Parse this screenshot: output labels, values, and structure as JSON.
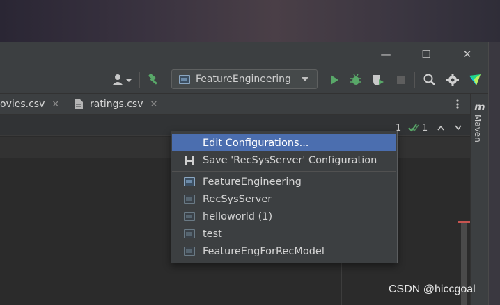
{
  "window": {
    "minimize_glyph": "—",
    "maximize_glyph": "☐",
    "close_glyph": "✕"
  },
  "toolbar": {
    "run_config_label": "FeatureEngineering",
    "icons": [
      "user-icon",
      "hammer-icon",
      "run-icon",
      "debug-icon",
      "coverage-icon",
      "stop-icon",
      "search-icon",
      "gear-icon",
      "toolbox-icon"
    ]
  },
  "tabs": [
    {
      "label": "ovies.csv",
      "close": "✕"
    },
    {
      "label": "ratings.csv",
      "close": "✕"
    }
  ],
  "inspections": {
    "warnings_count": "1",
    "ok_count": "1"
  },
  "sidebar": {
    "maven_label": "Maven",
    "maven_glyph": "m"
  },
  "dropdown": {
    "items": [
      {
        "label": "Edit Configurations...",
        "icon": "none",
        "selected": true
      },
      {
        "label": "Save 'RecSysServer' Configuration",
        "icon": "save-icon",
        "selected": false
      },
      {
        "label": "FeatureEngineering",
        "icon": "config-icon",
        "selected": false
      },
      {
        "label": "RecSysServer",
        "icon": "config-icon-dim",
        "selected": false
      },
      {
        "label": "helloworld (1)",
        "icon": "config-icon-dim",
        "selected": false
      },
      {
        "label": "test",
        "icon": "config-icon-dim",
        "selected": false
      },
      {
        "label": "FeatureEngForRecModel",
        "icon": "config-icon-dim",
        "selected": false
      }
    ]
  },
  "watermark": "CSDN @hiccgoal",
  "colors": {
    "selection": "#4b6eaf",
    "run_green": "#59a869",
    "debug_green": "#59a869"
  }
}
